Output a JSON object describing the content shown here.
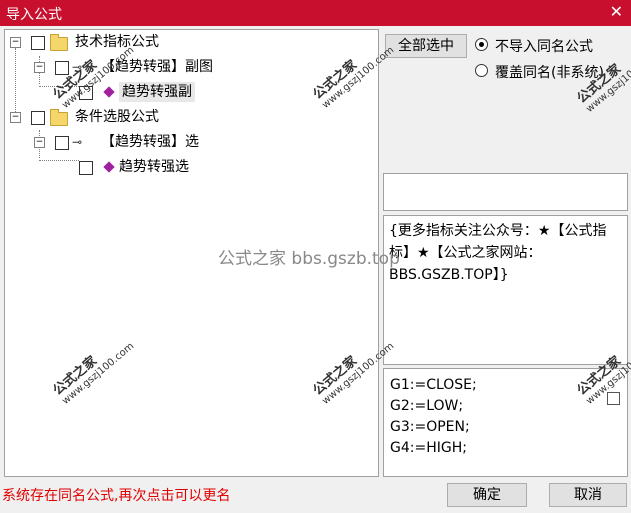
{
  "window": {
    "title": "导入公式",
    "close_label": "✕"
  },
  "tree": {
    "group1": {
      "label": "技术指标公式"
    },
    "group1_child": {
      "label": "【趋势转强】副图"
    },
    "group1_leaf": {
      "label": "趋势转强副"
    },
    "group2": {
      "label": "条件选股公式"
    },
    "group2_child": {
      "label": "【趋势转强】选"
    },
    "group2_leaf": {
      "label": "趋势转强选"
    }
  },
  "controls": {
    "select_all_label": "全部选中",
    "radio_skip_label": "不导入同名公式",
    "radio_overwrite_label": "覆盖同名(非系统)",
    "radio_selected": "skip"
  },
  "description": "{更多指标关注公众号：★【公式指标】★【公式之家网站：BBS.GSZB.TOP】}",
  "code_lines": "G1:=CLOSE;\nG2:=LOW;\nG3:=OPEN;\nG4:=HIGH;",
  "status_text": "系统存在同名公式,再次点击可以更名",
  "buttons": {
    "ok_label": "确定",
    "cancel_label": "取消"
  },
  "watermark": {
    "main": "公式之家",
    "sub": "www.gszj100.com",
    "center": "公式之家 bbs.gszb.top"
  },
  "colors": {
    "titlebar": "#c8102e",
    "status": "#e00000"
  }
}
